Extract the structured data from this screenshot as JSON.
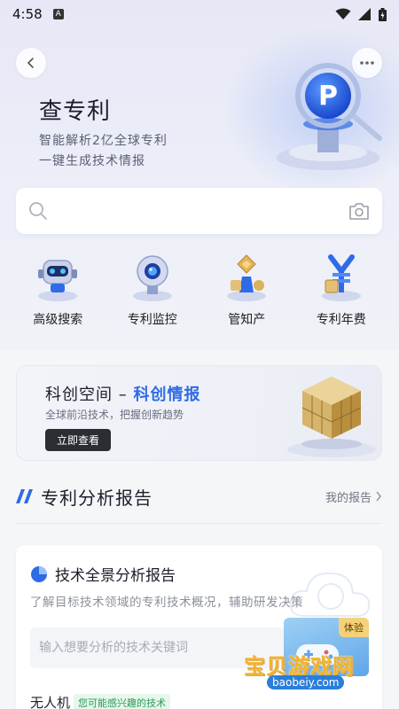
{
  "status_bar": {
    "time": "4:58",
    "notification_letter": "A"
  },
  "hero": {
    "title": "查专利",
    "subtitle_line1": "智能解析2亿全球专利",
    "subtitle_line2": "一键生成技术情报"
  },
  "search": {
    "placeholder": ""
  },
  "quick_actions": [
    {
      "label": "高级搜索",
      "icon": "robot-icon"
    },
    {
      "label": "专利监控",
      "icon": "camera-icon"
    },
    {
      "label": "管知产",
      "icon": "trophy-icon"
    },
    {
      "label": "专利年费",
      "icon": "yen-icon"
    }
  ],
  "banner": {
    "title_prefix": "科创空间 – ",
    "title_highlight": "科创情报",
    "subtitle": "全球前沿技术，把握创新趋势",
    "button_label": "立即查看"
  },
  "section": {
    "title": "专利分析报告",
    "link_label": "我的报告"
  },
  "report_card": {
    "title": "技术全景分析报告",
    "description": "了解目标技术领域的专利技术概况，辅助研发决策",
    "input_placeholder": "输入想要分析的技术关键词",
    "trial_badge": "体验",
    "suggestion_text": "无人机",
    "suggestion_tag": "您可能感兴趣的技术"
  },
  "watermark": {
    "text": "宝贝游戏网",
    "url": "baobeiy.com"
  },
  "colors": {
    "accent": "#2f6be6",
    "dark_button": "#2c2d33",
    "tag_green": "#2b9a54"
  }
}
